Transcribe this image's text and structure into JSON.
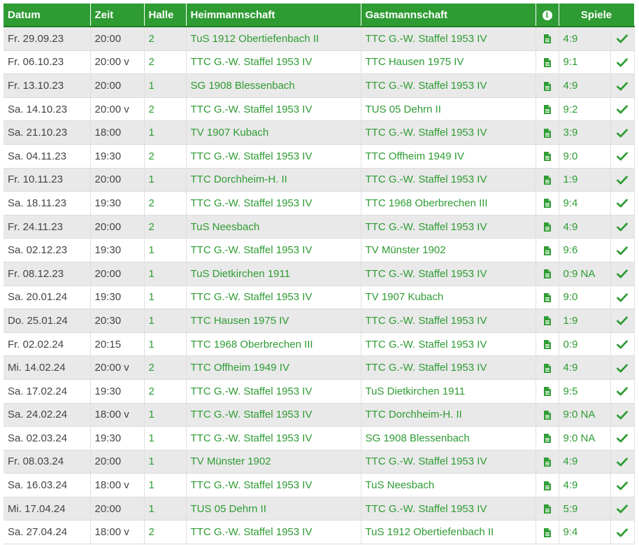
{
  "headers": {
    "datum": "Datum",
    "zeit": "Zeit",
    "halle": "Halle",
    "heim": "Heimmannschaft",
    "gast": "Gastmannschaft",
    "info": "i",
    "spiele": "Spiele"
  },
  "colors": {
    "accent": "#2e9c33",
    "header_bg": "#2e9c33",
    "row_alt": "#e9e9e9"
  },
  "icons": {
    "report": "document-icon",
    "status": "checkmark-icon",
    "info": "info-icon"
  },
  "rows": [
    {
      "datum": "Fr. 29.09.23",
      "zeit": "20:00",
      "halle": "2",
      "heim": "TuS 1912 Obertiefenbach II",
      "gast": "TTC G.-W. Staffel 1953 IV",
      "spiele": "4:9"
    },
    {
      "datum": "Fr. 06.10.23",
      "zeit": "20:00 v",
      "halle": "2",
      "heim": "TTC G.-W. Staffel 1953 IV",
      "gast": "TTC Hausen 1975 IV",
      "spiele": "9:1"
    },
    {
      "datum": "Fr. 13.10.23",
      "zeit": "20:00",
      "halle": "1",
      "heim": "SG 1908 Blessenbach",
      "gast": "TTC G.-W. Staffel 1953 IV",
      "spiele": "4:9"
    },
    {
      "datum": "Sa. 14.10.23",
      "zeit": "20:00 v",
      "halle": "2",
      "heim": "TTC G.-W. Staffel 1953 IV",
      "gast": "TUS 05 Dehrn II",
      "spiele": "9:2"
    },
    {
      "datum": "Sa. 21.10.23",
      "zeit": "18:00",
      "halle": "1",
      "heim": "TV 1907 Kubach",
      "gast": "TTC G.-W. Staffel 1953 IV",
      "spiele": "3:9"
    },
    {
      "datum": "Sa. 04.11.23",
      "zeit": "19:30",
      "halle": "2",
      "heim": "TTC G.-W. Staffel 1953 IV",
      "gast": "TTC Offheim 1949 IV",
      "spiele": "9:0"
    },
    {
      "datum": "Fr. 10.11.23",
      "zeit": "20:00",
      "halle": "1",
      "heim": "TTC Dorchheim-H. II",
      "gast": "TTC G.-W. Staffel 1953 IV",
      "spiele": "1:9"
    },
    {
      "datum": "Sa. 18.11.23",
      "zeit": "19:30",
      "halle": "2",
      "heim": "TTC G.-W. Staffel 1953 IV",
      "gast": "TTC 1968 Oberbrechen III",
      "spiele": "9:4"
    },
    {
      "datum": "Fr. 24.11.23",
      "zeit": "20:00",
      "halle": "2",
      "heim": "TuS Neesbach",
      "gast": "TTC G.-W. Staffel 1953 IV",
      "spiele": "4:9"
    },
    {
      "datum": "Sa. 02.12.23",
      "zeit": "19:30",
      "halle": "1",
      "heim": "TTC G.-W. Staffel 1953 IV",
      "gast": "TV Münster 1902",
      "spiele": "9:6"
    },
    {
      "datum": "Fr. 08.12.23",
      "zeit": "20:00",
      "halle": "1",
      "heim": "TuS Dietkirchen 1911",
      "gast": "TTC G.-W. Staffel 1953 IV",
      "spiele": "0:9 NA"
    },
    {
      "datum": "Sa. 20.01.24",
      "zeit": "19:30",
      "halle": "1",
      "heim": "TTC G.-W. Staffel 1953 IV",
      "gast": "TV 1907 Kubach",
      "spiele": "9:0"
    },
    {
      "datum": "Do. 25.01.24",
      "zeit": "20:30",
      "halle": "1",
      "heim": "TTC Hausen 1975 IV",
      "gast": "TTC G.-W. Staffel 1953 IV",
      "spiele": "1:9"
    },
    {
      "datum": "Fr. 02.02.24",
      "zeit": "20:15",
      "halle": "1",
      "heim": "TTC 1968 Oberbrechen III",
      "gast": "TTC G.-W. Staffel 1953 IV",
      "spiele": "0:9"
    },
    {
      "datum": "Mi. 14.02.24",
      "zeit": "20:00 v",
      "halle": "2",
      "heim": "TTC Offheim 1949 IV",
      "gast": "TTC G.-W. Staffel 1953 IV",
      "spiele": "4:9"
    },
    {
      "datum": "Sa. 17.02.24",
      "zeit": "19:30",
      "halle": "2",
      "heim": "TTC G.-W. Staffel 1953 IV",
      "gast": "TuS Dietkirchen 1911",
      "spiele": "9:5"
    },
    {
      "datum": "Sa. 24.02.24",
      "zeit": "18:00 v",
      "halle": "1",
      "heim": "TTC G.-W. Staffel 1953 IV",
      "gast": "TTC Dorchheim-H. II",
      "spiele": "9:0 NA"
    },
    {
      "datum": "Sa. 02.03.24",
      "zeit": "19:30",
      "halle": "1",
      "heim": "TTC G.-W. Staffel 1953 IV",
      "gast": "SG 1908 Blessenbach",
      "spiele": "9:0 NA"
    },
    {
      "datum": "Fr. 08.03.24",
      "zeit": "20:00",
      "halle": "1",
      "heim": "TV Münster 1902",
      "gast": "TTC G.-W. Staffel 1953 IV",
      "spiele": "4:9"
    },
    {
      "datum": "Sa. 16.03.24",
      "zeit": "18:00 v",
      "halle": "1",
      "heim": "TTC G.-W. Staffel 1953 IV",
      "gast": "TuS Neesbach",
      "spiele": "4:9"
    },
    {
      "datum": "Mi. 17.04.24",
      "zeit": "20:00",
      "halle": "1",
      "heim": "TUS 05 Dehrn II",
      "gast": "TTC G.-W. Staffel 1953 IV",
      "spiele": "5:9"
    },
    {
      "datum": "Sa. 27.04.24",
      "zeit": "18:00 v",
      "halle": "2",
      "heim": "TTC G.-W. Staffel 1953 IV",
      "gast": "TuS 1912 Obertiefenbach II",
      "spiele": "9:4"
    }
  ]
}
